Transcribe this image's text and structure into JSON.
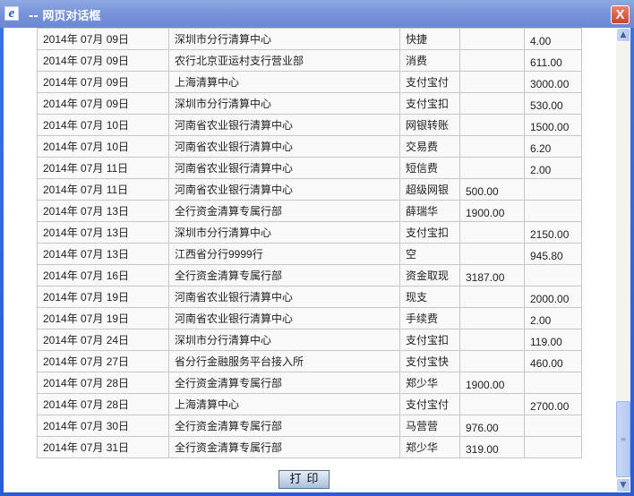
{
  "window": {
    "title": "-- 网页对话框",
    "close_label": "X",
    "icon": "ie-icon"
  },
  "rows": [
    [
      "2014年 07月 09日",
      "深圳市分行清算中心",
      "快捷",
      "",
      "4.00"
    ],
    [
      "2014年 07月 09日",
      "农行北京亚运村支行营业部",
      "消费",
      "",
      "611.00"
    ],
    [
      "2014年 07月 09日",
      "上海清算中心",
      "支付宝付",
      "",
      "3000.00"
    ],
    [
      "2014年 07月 09日",
      "深圳市分行清算中心",
      "支付宝扣",
      "",
      "530.00"
    ],
    [
      "2014年 07月 10日",
      "河南省农业银行清算中心",
      "网银转账",
      "",
      "1500.00"
    ],
    [
      "2014年 07月 10日",
      "河南省农业银行清算中心",
      "交易费",
      "",
      "6.20"
    ],
    [
      "2014年 07月 11日",
      "河南省农业银行清算中心",
      "短信费",
      "",
      "2.00"
    ],
    [
      "2014年 07月 11日",
      "河南省农业银行清算中心",
      "超级网银",
      "500.00",
      ""
    ],
    [
      "2014年 07月 13日",
      "全行资金清算专属行部",
      "薛瑞华",
      "1900.00",
      ""
    ],
    [
      "2014年 07月 13日",
      "深圳市分行清算中心",
      "支付宝扣",
      "",
      "2150.00"
    ],
    [
      "2014年 07月 13日",
      "江西省分行9999行",
      "空",
      "",
      "945.80"
    ],
    [
      "2014年 07月 16日",
      "全行资金清算专属行部",
      "资金取现",
      "3187.00",
      ""
    ],
    [
      "2014年 07月 19日",
      "河南省农业银行清算中心",
      "现支",
      "",
      "2000.00"
    ],
    [
      "2014年 07月 19日",
      "河南省农业银行清算中心",
      "手续费",
      "",
      "2.00"
    ],
    [
      "2014年 07月 24日",
      "深圳市分行清算中心",
      "支付宝扣",
      "",
      "119.00"
    ],
    [
      "2014年 07月 27日",
      "省分行金融服务平台接入所",
      "支付宝快",
      "",
      "460.00"
    ],
    [
      "2014年 07月 28日",
      "全行资金清算专属行部",
      "郑少华",
      "1900.00",
      ""
    ],
    [
      "2014年 07月 28日",
      "上海清算中心",
      "支付宝付",
      "",
      "2700.00"
    ],
    [
      "2014年 07月 30日",
      "全行资金清算专属行部",
      "马营营",
      "976.00",
      ""
    ],
    [
      "2014年 07月 31日",
      "全行资金清算专属行部",
      "郑少华",
      "319.00",
      ""
    ]
  ],
  "print_button": "打印",
  "scrollbar": {
    "position_percent": 100
  }
}
